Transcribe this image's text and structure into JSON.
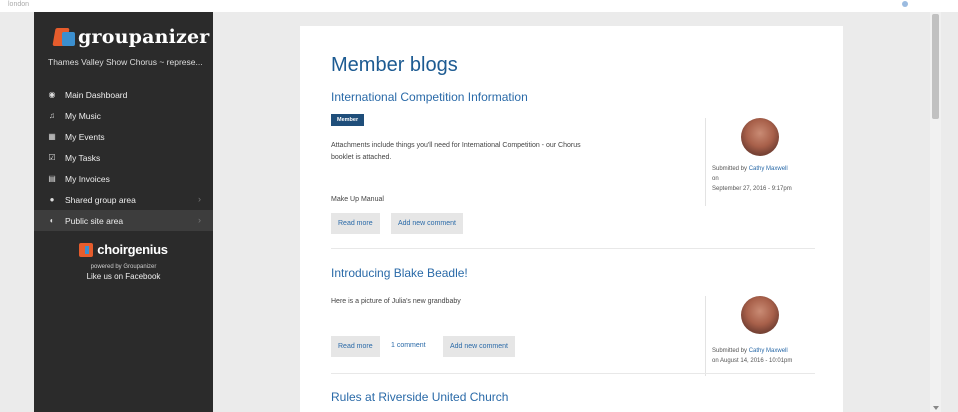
{
  "sidebar": {
    "brand": "groupanizer",
    "group_name": "Thames Valley Show Chorus ~ represe...",
    "items": [
      {
        "label": "Main Dashboard"
      },
      {
        "label": "My Music"
      },
      {
        "label": "My Events"
      },
      {
        "label": "My Tasks"
      },
      {
        "label": "My Invoices"
      },
      {
        "label": "Shared group area"
      },
      {
        "label": "Public site area"
      }
    ],
    "footer": {
      "brand": "choirgenius",
      "powered": "powered by Groupanizer",
      "facebook": "Like us on Facebook"
    }
  },
  "main": {
    "title": "Member blogs",
    "posts": [
      {
        "title": "International Competition Information",
        "badge": "Member",
        "body_line1": "Attachments include things you'll need for International Competition - our Chorus",
        "body_line2": "booklet is attached.",
        "attachment": "Make Up Manual",
        "read_more": "Read more",
        "add_comment": "Add new comment",
        "submitted_by": "Submitted by",
        "author": "Cathy Maxwell",
        "on": "on",
        "date": "September 27, 2016 - 9:17pm"
      },
      {
        "title": "Introducing Blake Beadle!",
        "body": "Here is a picture of Julia's new grandbaby",
        "read_more": "Read more",
        "comments": "1 comment",
        "add_comment": "Add new comment",
        "submitted_by": "Submitted by",
        "author": "Cathy Maxwell",
        "date_line": "on August 14, 2016 - 10:01pm"
      },
      {
        "title": "Rules at Riverside United Church"
      }
    ]
  }
}
